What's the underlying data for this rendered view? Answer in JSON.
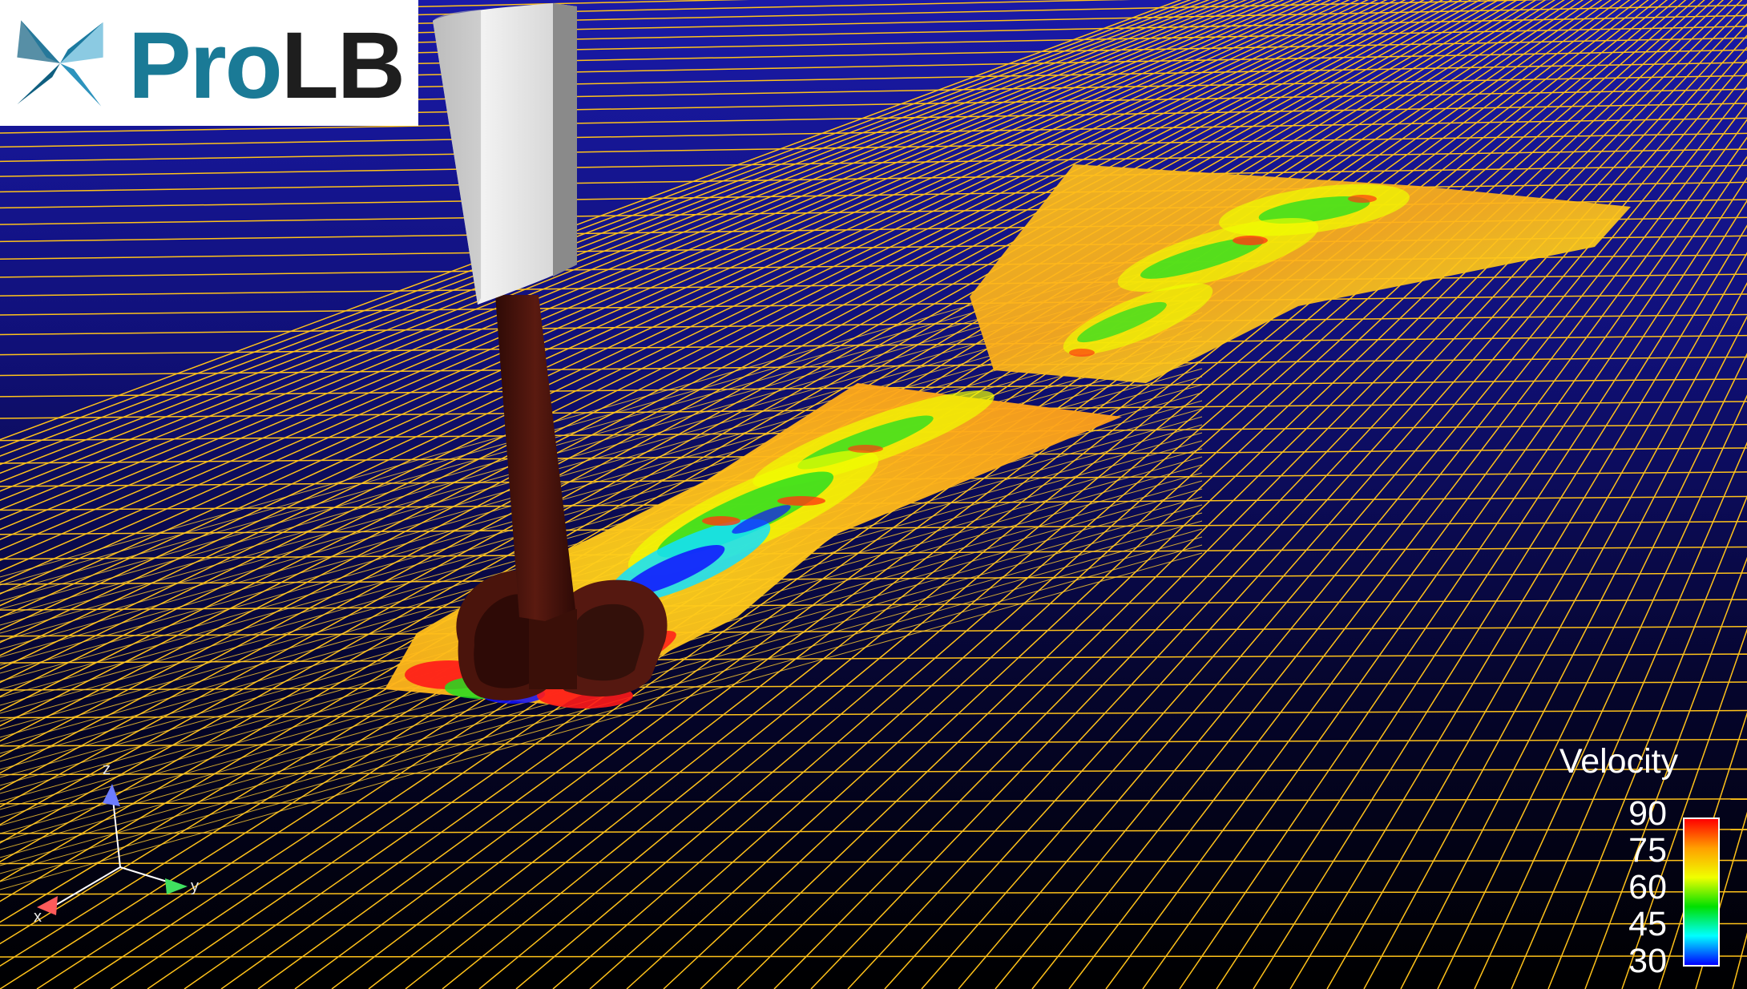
{
  "brand": {
    "name_pro": "Pro",
    "name_lb": "LB",
    "color_pro": "#1a7a96",
    "color_lb": "#1e1e1e",
    "icon": "pinwheel-logo-icon"
  },
  "scene": {
    "background_top": "#1a1aa8",
    "background_bottom": "#000000",
    "mesh_color": "#ffc21a",
    "strut_color": "#4a140c",
    "fairing_color": "#e4e4e4"
  },
  "legend": {
    "title": "Velocity",
    "ticks": [
      "90",
      "75",
      "60",
      "45",
      "30"
    ],
    "colors": [
      "#ff0000",
      "#ffa000",
      "#f0ff00",
      "#00e000",
      "#00ffff",
      "#0000ff"
    ]
  },
  "axes": {
    "x_label": "x",
    "y_label": "y",
    "z_label": "z",
    "x_color": "#ff5a5a",
    "y_color": "#40e060",
    "z_color": "#6c7cff"
  }
}
